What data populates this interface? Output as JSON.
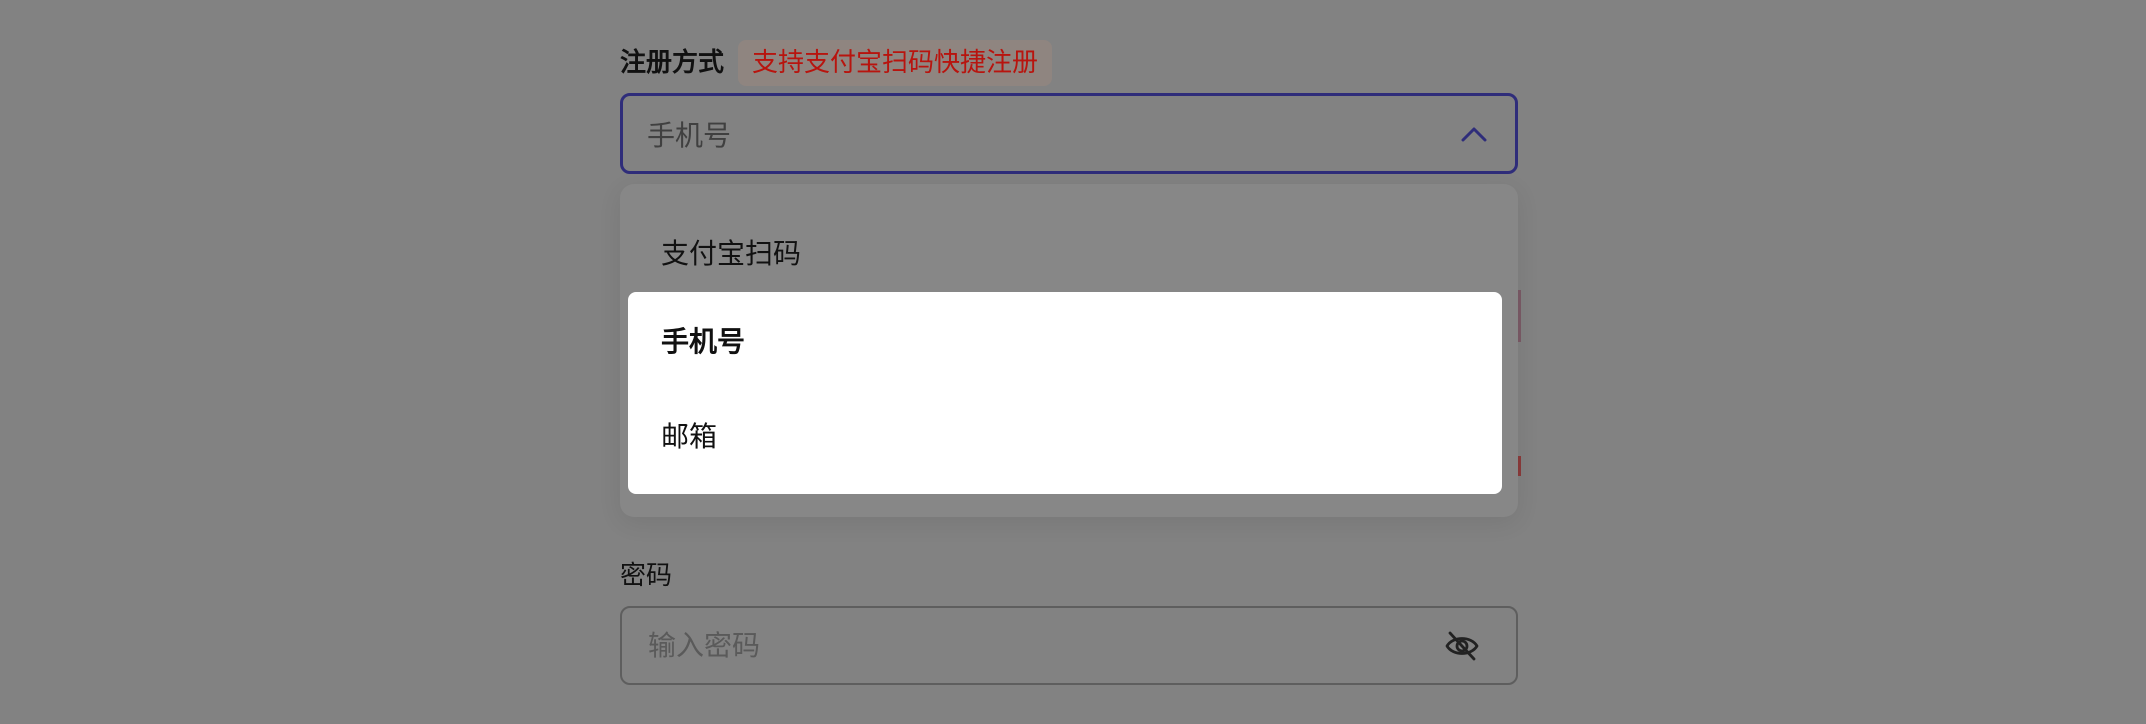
{
  "register_method": {
    "label": "注册方式",
    "badge": "支持支付宝扫码快捷注册",
    "selected_value": "手机号",
    "options": [
      {
        "label": "支付宝扫码"
      },
      {
        "label": "手机号"
      },
      {
        "label": "邮箱"
      }
    ]
  },
  "password": {
    "label": "密码",
    "placeholder": "输入密码"
  },
  "icons": {
    "chevron": "chevron-up-icon",
    "eye": "eye-off-icon"
  },
  "colors": {
    "focus_border": "#2f2d7a",
    "badge_text": "#b8140e"
  }
}
